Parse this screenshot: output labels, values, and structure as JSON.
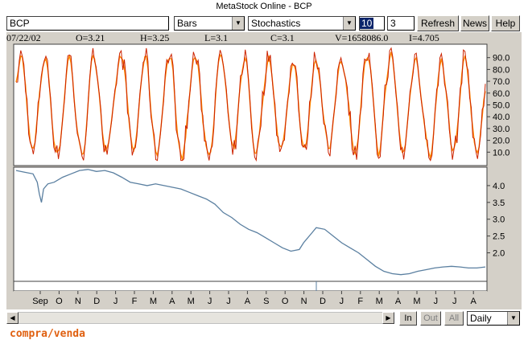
{
  "window": {
    "title": "MetaStock Online - BCP"
  },
  "toolbar": {
    "symbol_value": "BCP",
    "chart_type": "Bars",
    "indicator": "Stochastics",
    "param1": "10",
    "param2": "3",
    "refresh_label": "Refresh",
    "news_label": "News",
    "help_label": "Help"
  },
  "info": {
    "date": "07/22/02",
    "open": "O=3.21",
    "high": "H=3.25",
    "low": "L=3.1",
    "close": "C=3.1",
    "volume": "V=1658086.0",
    "i": "I=4.705"
  },
  "chart_data": [
    {
      "type": "line",
      "name": "Stochastics",
      "y_ticks": [
        "90.0",
        "80.0",
        "70.0",
        "60.0",
        "50.0",
        "40.0",
        "30.0",
        "20.0",
        "10.0"
      ],
      "ylim": [
        0,
        100
      ],
      "colors": {
        "k": "#cc2200",
        "d": "#ff8800"
      },
      "y_start": 72
    },
    {
      "type": "line",
      "name": "BCP price",
      "y_ticks": [
        "4.0",
        "3.5",
        "3.0",
        "2.5",
        "2.0"
      ],
      "ylim": [
        1.2,
        4.5
      ],
      "color": "#5a7fa0",
      "points": [
        [
          0,
          4.45
        ],
        [
          4,
          4.4
        ],
        [
          8,
          4.35
        ],
        [
          10,
          4.1
        ],
        [
          11,
          3.75
        ],
        [
          12,
          3.5
        ],
        [
          13,
          3.9
        ],
        [
          15,
          4.05
        ],
        [
          18,
          4.1
        ],
        [
          22,
          4.25
        ],
        [
          26,
          4.35
        ],
        [
          30,
          4.45
        ],
        [
          34,
          4.48
        ],
        [
          38,
          4.42
        ],
        [
          42,
          4.45
        ],
        [
          46,
          4.38
        ],
        [
          50,
          4.25
        ],
        [
          54,
          4.1
        ],
        [
          58,
          4.05
        ],
        [
          62,
          4.0
        ],
        [
          66,
          4.05
        ],
        [
          70,
          4.0
        ],
        [
          74,
          3.95
        ],
        [
          78,
          3.9
        ],
        [
          82,
          3.8
        ],
        [
          86,
          3.7
        ],
        [
          90,
          3.6
        ],
        [
          94,
          3.45
        ],
        [
          98,
          3.2
        ],
        [
          102,
          3.05
        ],
        [
          106,
          2.85
        ],
        [
          110,
          2.7
        ],
        [
          114,
          2.6
        ],
        [
          118,
          2.45
        ],
        [
          122,
          2.3
        ],
        [
          126,
          2.15
        ],
        [
          130,
          2.05
        ],
        [
          134,
          2.1
        ],
        [
          136,
          2.3
        ],
        [
          140,
          2.6
        ],
        [
          142,
          2.75
        ],
        [
          146,
          2.7
        ],
        [
          150,
          2.5
        ],
        [
          154,
          2.3
        ],
        [
          158,
          2.15
        ],
        [
          162,
          2.0
        ],
        [
          166,
          1.8
        ],
        [
          170,
          1.6
        ],
        [
          174,
          1.45
        ],
        [
          178,
          1.38
        ],
        [
          182,
          1.35
        ],
        [
          186,
          1.38
        ],
        [
          190,
          1.45
        ],
        [
          194,
          1.5
        ],
        [
          198,
          1.55
        ],
        [
          202,
          1.58
        ],
        [
          206,
          1.6
        ],
        [
          210,
          1.58
        ],
        [
          214,
          1.55
        ],
        [
          218,
          1.55
        ],
        [
          222,
          1.58
        ]
      ]
    }
  ],
  "x_axis": {
    "ticks": [
      "Sep",
      "O",
      "N",
      "D",
      "J",
      "F",
      "M",
      "A",
      "M",
      "J",
      "J",
      "A",
      "S",
      "O",
      "N",
      "D",
      "J",
      "F",
      "M",
      "A",
      "M",
      "J",
      "J",
      "A"
    ]
  },
  "bottom": {
    "in_label": "In",
    "out_label": "Out",
    "all_label": "All",
    "period": "Daily"
  },
  "footer": {
    "text": "compra/venda"
  }
}
